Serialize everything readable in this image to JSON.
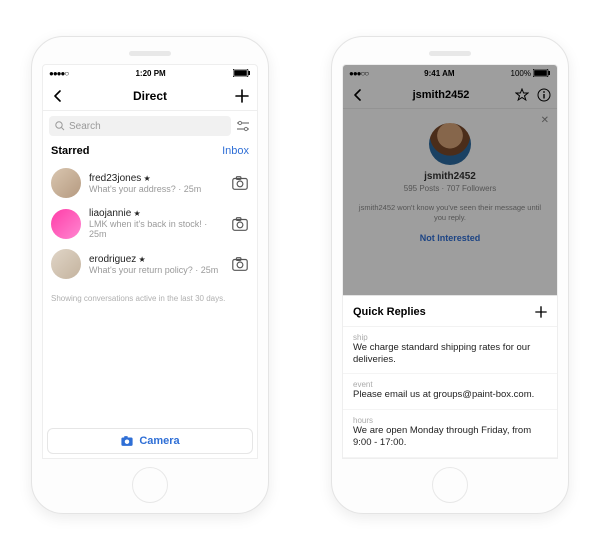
{
  "left": {
    "status": {
      "carrier": "●●●●○",
      "time": "1:20 PM"
    },
    "nav_title": "Direct",
    "search_placeholder": "Search",
    "section_label": "Starred",
    "section_link": "Inbox",
    "rows": [
      {
        "name": "fred23jones",
        "sub": "What's your address? · 25m"
      },
      {
        "name": "liaojannie",
        "sub": "LMK when it's back in stock! · 25m"
      },
      {
        "name": "erodriguez",
        "sub": "What's your return policy? · 25m"
      }
    ],
    "footer_note": "Showing conversations active in the last 30 days.",
    "camera_label": "Camera"
  },
  "right": {
    "status": {
      "carrier": "●●●○○",
      "time": "9:41 AM",
      "pct": "100%"
    },
    "nav_title": "jsmith2452",
    "profile": {
      "username": "jsmith2452",
      "stats": "595 Posts · 707 Followers",
      "note": "jsmith2452 won't know you've seen their message until you reply.",
      "not_interested": "Not Interested"
    },
    "sheet_title": "Quick Replies",
    "replies": [
      {
        "short": "ship",
        "msg": "We charge standard shipping rates for our deliveries."
      },
      {
        "short": "event",
        "msg": "Please email us at groups@paint-box.com."
      },
      {
        "short": "hours",
        "msg": "We are open Monday through Friday, from 9:00 - 17:00."
      }
    ]
  }
}
